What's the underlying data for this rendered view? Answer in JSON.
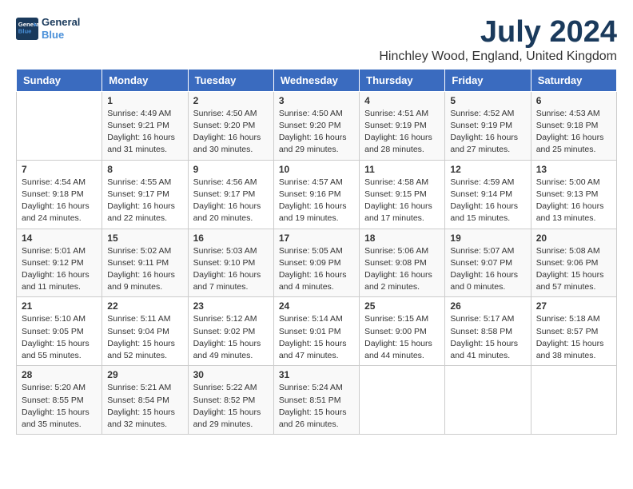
{
  "logo": {
    "line1": "General",
    "line2": "Blue"
  },
  "title": "July 2024",
  "location": "Hinchley Wood, England, United Kingdom",
  "days_header": [
    "Sunday",
    "Monday",
    "Tuesday",
    "Wednesday",
    "Thursday",
    "Friday",
    "Saturday"
  ],
  "weeks": [
    [
      {
        "num": "",
        "info": ""
      },
      {
        "num": "1",
        "info": "Sunrise: 4:49 AM\nSunset: 9:21 PM\nDaylight: 16 hours\nand 31 minutes."
      },
      {
        "num": "2",
        "info": "Sunrise: 4:50 AM\nSunset: 9:20 PM\nDaylight: 16 hours\nand 30 minutes."
      },
      {
        "num": "3",
        "info": "Sunrise: 4:50 AM\nSunset: 9:20 PM\nDaylight: 16 hours\nand 29 minutes."
      },
      {
        "num": "4",
        "info": "Sunrise: 4:51 AM\nSunset: 9:19 PM\nDaylight: 16 hours\nand 28 minutes."
      },
      {
        "num": "5",
        "info": "Sunrise: 4:52 AM\nSunset: 9:19 PM\nDaylight: 16 hours\nand 27 minutes."
      },
      {
        "num": "6",
        "info": "Sunrise: 4:53 AM\nSunset: 9:18 PM\nDaylight: 16 hours\nand 25 minutes."
      }
    ],
    [
      {
        "num": "7",
        "info": "Sunrise: 4:54 AM\nSunset: 9:18 PM\nDaylight: 16 hours\nand 24 minutes."
      },
      {
        "num": "8",
        "info": "Sunrise: 4:55 AM\nSunset: 9:17 PM\nDaylight: 16 hours\nand 22 minutes."
      },
      {
        "num": "9",
        "info": "Sunrise: 4:56 AM\nSunset: 9:17 PM\nDaylight: 16 hours\nand 20 minutes."
      },
      {
        "num": "10",
        "info": "Sunrise: 4:57 AM\nSunset: 9:16 PM\nDaylight: 16 hours\nand 19 minutes."
      },
      {
        "num": "11",
        "info": "Sunrise: 4:58 AM\nSunset: 9:15 PM\nDaylight: 16 hours\nand 17 minutes."
      },
      {
        "num": "12",
        "info": "Sunrise: 4:59 AM\nSunset: 9:14 PM\nDaylight: 16 hours\nand 15 minutes."
      },
      {
        "num": "13",
        "info": "Sunrise: 5:00 AM\nSunset: 9:13 PM\nDaylight: 16 hours\nand 13 minutes."
      }
    ],
    [
      {
        "num": "14",
        "info": "Sunrise: 5:01 AM\nSunset: 9:12 PM\nDaylight: 16 hours\nand 11 minutes."
      },
      {
        "num": "15",
        "info": "Sunrise: 5:02 AM\nSunset: 9:11 PM\nDaylight: 16 hours\nand 9 minutes."
      },
      {
        "num": "16",
        "info": "Sunrise: 5:03 AM\nSunset: 9:10 PM\nDaylight: 16 hours\nand 7 minutes."
      },
      {
        "num": "17",
        "info": "Sunrise: 5:05 AM\nSunset: 9:09 PM\nDaylight: 16 hours\nand 4 minutes."
      },
      {
        "num": "18",
        "info": "Sunrise: 5:06 AM\nSunset: 9:08 PM\nDaylight: 16 hours\nand 2 minutes."
      },
      {
        "num": "19",
        "info": "Sunrise: 5:07 AM\nSunset: 9:07 PM\nDaylight: 16 hours\nand 0 minutes."
      },
      {
        "num": "20",
        "info": "Sunrise: 5:08 AM\nSunset: 9:06 PM\nDaylight: 15 hours\nand 57 minutes."
      }
    ],
    [
      {
        "num": "21",
        "info": "Sunrise: 5:10 AM\nSunset: 9:05 PM\nDaylight: 15 hours\nand 55 minutes."
      },
      {
        "num": "22",
        "info": "Sunrise: 5:11 AM\nSunset: 9:04 PM\nDaylight: 15 hours\nand 52 minutes."
      },
      {
        "num": "23",
        "info": "Sunrise: 5:12 AM\nSunset: 9:02 PM\nDaylight: 15 hours\nand 49 minutes."
      },
      {
        "num": "24",
        "info": "Sunrise: 5:14 AM\nSunset: 9:01 PM\nDaylight: 15 hours\nand 47 minutes."
      },
      {
        "num": "25",
        "info": "Sunrise: 5:15 AM\nSunset: 9:00 PM\nDaylight: 15 hours\nand 44 minutes."
      },
      {
        "num": "26",
        "info": "Sunrise: 5:17 AM\nSunset: 8:58 PM\nDaylight: 15 hours\nand 41 minutes."
      },
      {
        "num": "27",
        "info": "Sunrise: 5:18 AM\nSunset: 8:57 PM\nDaylight: 15 hours\nand 38 minutes."
      }
    ],
    [
      {
        "num": "28",
        "info": "Sunrise: 5:20 AM\nSunset: 8:55 PM\nDaylight: 15 hours\nand 35 minutes."
      },
      {
        "num": "29",
        "info": "Sunrise: 5:21 AM\nSunset: 8:54 PM\nDaylight: 15 hours\nand 32 minutes."
      },
      {
        "num": "30",
        "info": "Sunrise: 5:22 AM\nSunset: 8:52 PM\nDaylight: 15 hours\nand 29 minutes."
      },
      {
        "num": "31",
        "info": "Sunrise: 5:24 AM\nSunset: 8:51 PM\nDaylight: 15 hours\nand 26 minutes."
      },
      {
        "num": "",
        "info": ""
      },
      {
        "num": "",
        "info": ""
      },
      {
        "num": "",
        "info": ""
      }
    ]
  ]
}
